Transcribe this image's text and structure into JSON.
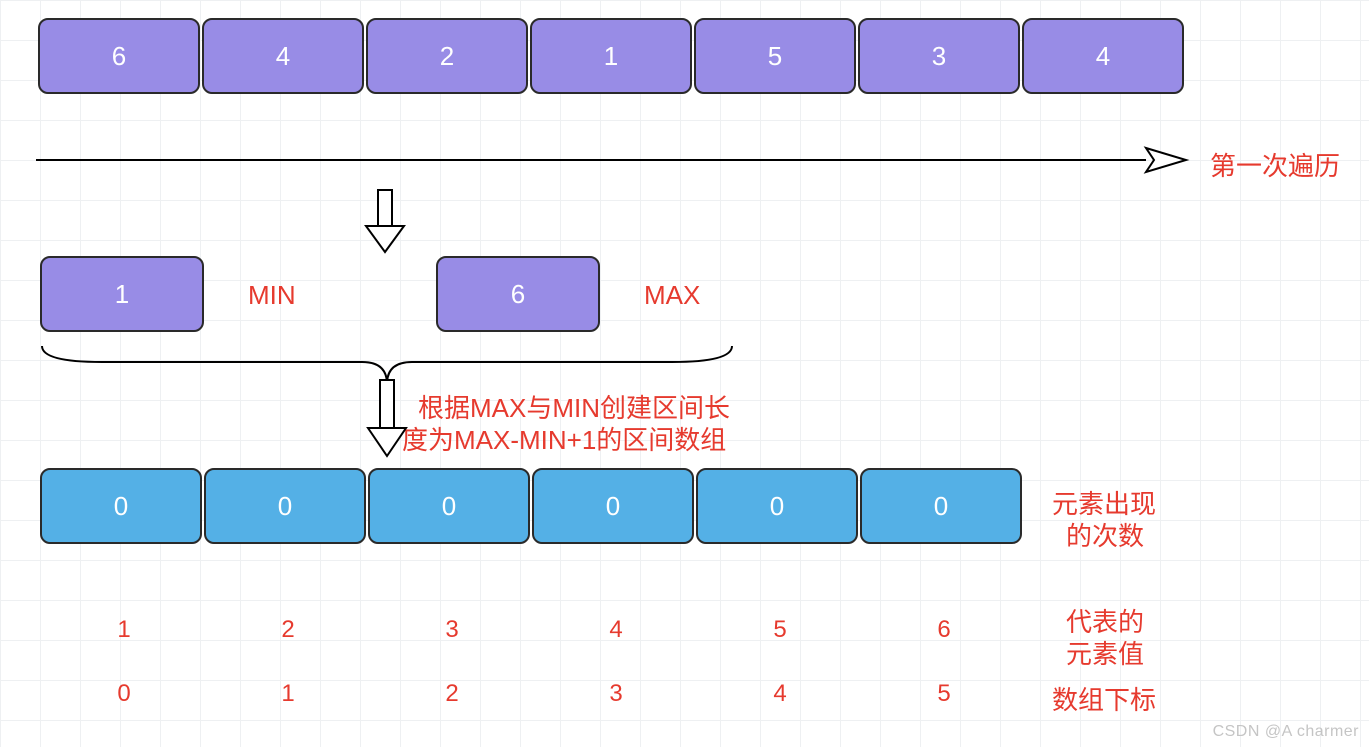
{
  "inputArray": [
    "6",
    "4",
    "2",
    "1",
    "5",
    "3",
    "4"
  ],
  "passLabel": "第一次遍历",
  "min": {
    "value": "1",
    "label": "MIN"
  },
  "max": {
    "value": "6",
    "label": "MAX"
  },
  "createLine1": "根据MAX与MIN创建区间长",
  "createLine2": "度为MAX-MIN+1的区间数组",
  "countArray": [
    "0",
    "0",
    "0",
    "0",
    "0",
    "0"
  ],
  "countLabel1": "元素出现",
  "countLabel2": "的次数",
  "valuesRow": [
    "1",
    "2",
    "3",
    "4",
    "5",
    "6"
  ],
  "valuesLabel1": "代表的",
  "valuesLabel2": "元素值",
  "indexRow": [
    "0",
    "1",
    "2",
    "3",
    "4",
    "5"
  ],
  "indexLabel": "数组下标",
  "watermark": "CSDN @A charmer"
}
